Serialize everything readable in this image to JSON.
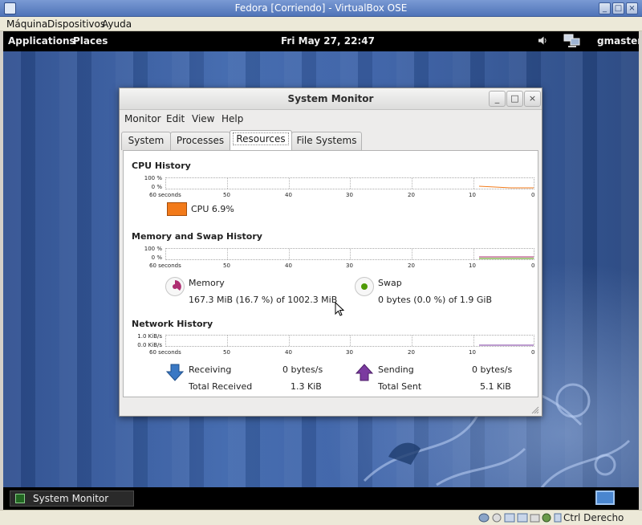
{
  "host": {
    "title": "Fedora [Corriendo] - VirtualBox OSE",
    "menu": [
      "Máquina",
      "Dispositivos",
      "Ayuda"
    ],
    "controls": [
      "_",
      "□",
      "×"
    ],
    "status": {
      "host_key": "Ctrl Derecho"
    }
  },
  "top_panel": {
    "applications": "Applications",
    "places": "Places",
    "clock": "Fri May 27, 22:47",
    "user": "gmaster"
  },
  "taskbar": {
    "item": "System Monitor"
  },
  "window": {
    "title": "System Monitor",
    "controls": [
      "_",
      "□",
      "×"
    ],
    "menu": [
      "Monitor",
      "Edit",
      "View",
      "Help"
    ],
    "tabs": [
      "System",
      "Processes",
      "Resources",
      "File Systems"
    ],
    "active_tab": "Resources"
  },
  "cpu": {
    "heading": "CPU History",
    "y_top": "100 %",
    "y_bottom": "0 %",
    "legend": "CPU  6.9%",
    "color": "#f27a1a"
  },
  "memory": {
    "heading": "Memory and Swap History",
    "y_top": "100 %",
    "y_bottom": "0 %",
    "mem_label": "Memory",
    "mem_value": "167.3 MiB (16.7 %) of 1002.3 MiB",
    "swap_label": "Swap",
    "swap_value": "0 bytes (0.0 %) of 1.9 GiB",
    "mem_color": "#ae2e72",
    "swap_color": "#4e9a06"
  },
  "network": {
    "heading": "Network History",
    "y_top": "1.0 KiB/s",
    "y_bottom": "0.0 KiB/s",
    "receiving_label": "Receiving",
    "receiving_value": "0 bytes/s",
    "total_received_label": "Total Received",
    "total_received_value": "1.3 KiB",
    "sending_label": "Sending",
    "sending_value": "0 bytes/s",
    "total_sent_label": "Total Sent",
    "total_sent_value": "5.1 KiB",
    "recv_color": "#3a78c4",
    "send_color": "#7b3aa0"
  },
  "x_axis": [
    "60 seconds",
    "50",
    "40",
    "30",
    "20",
    "10",
    "0"
  ]
}
